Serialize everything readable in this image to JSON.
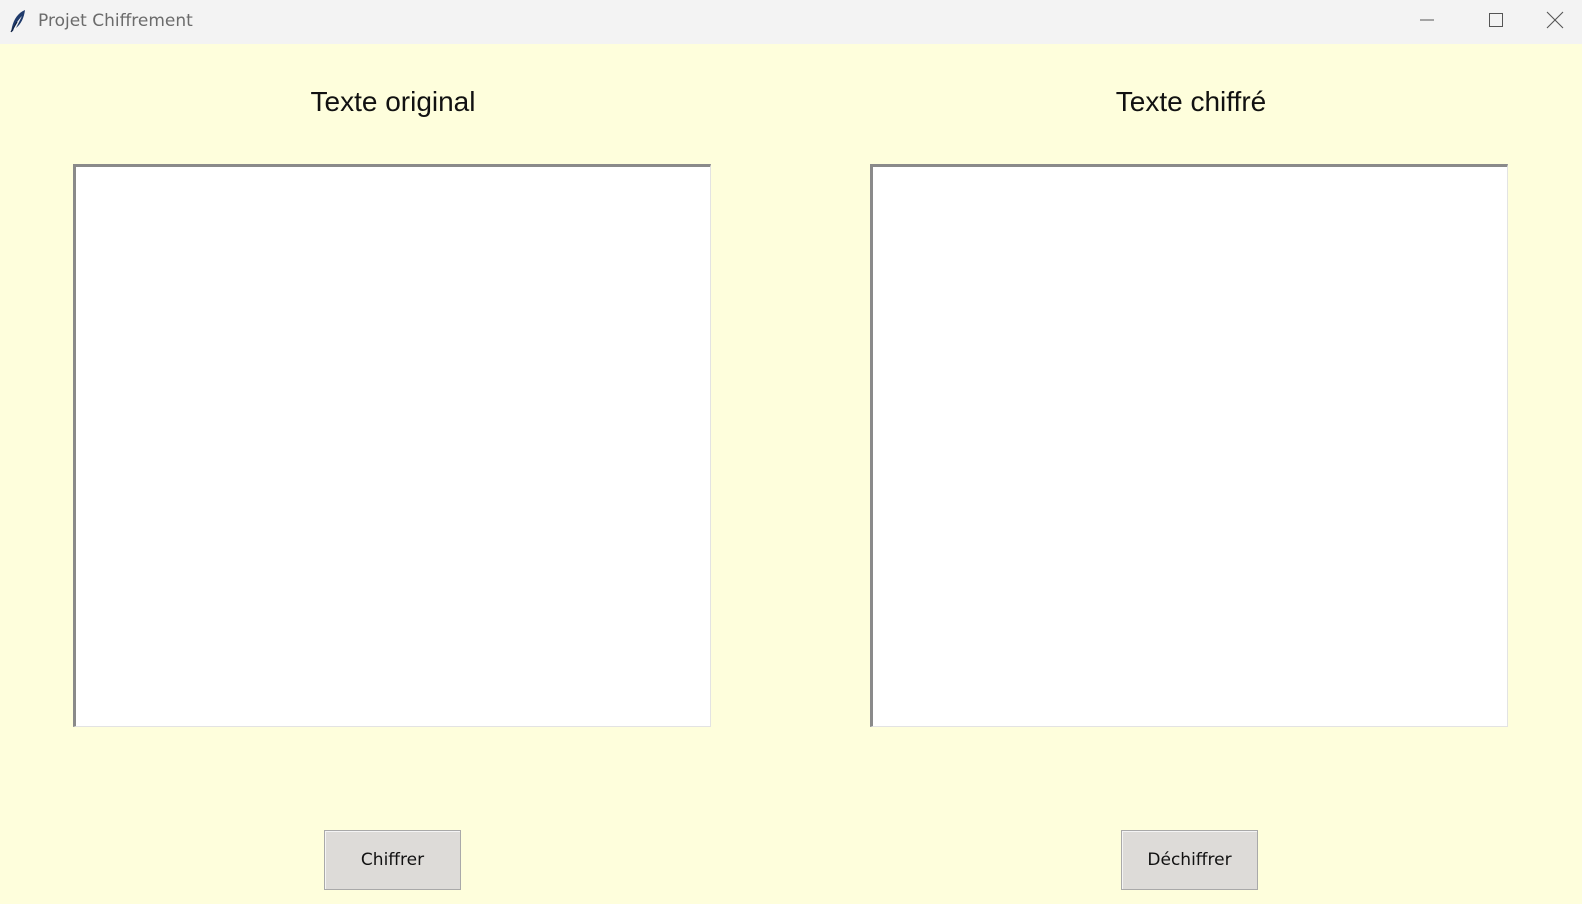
{
  "window": {
    "title": "Projet Chiffrement",
    "background_color": "#fefedc",
    "titlebar_color": "#f3f3f3",
    "icons": {
      "app": "feather-icon",
      "minimize": "minimize-icon",
      "maximize": "maximize-icon",
      "close": "close-icon"
    }
  },
  "left_panel": {
    "label": "Texte original",
    "text_value": ""
  },
  "right_panel": {
    "label": "Texte chiffré",
    "text_value": ""
  },
  "buttons": {
    "encrypt_label": "Chiffrer",
    "decrypt_label": "Déchiffrer",
    "button_color": "#dddbd8"
  }
}
